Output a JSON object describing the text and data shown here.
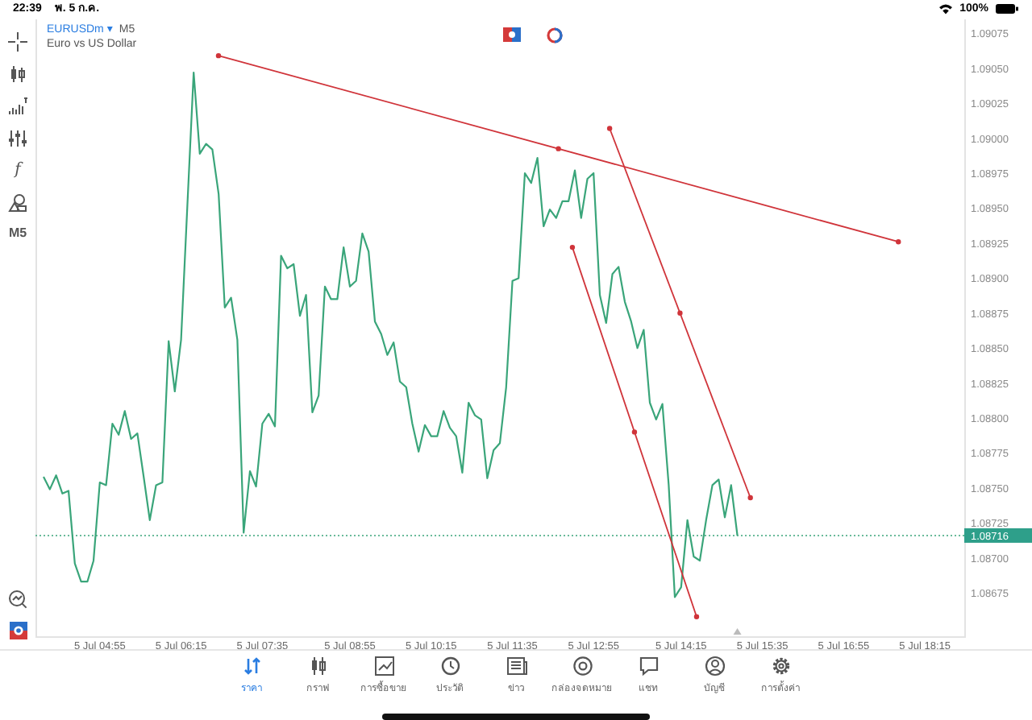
{
  "status_bar": {
    "time": "22:39",
    "date": "พ. 5 ก.ค.",
    "battery": "100%"
  },
  "toolbar": {
    "function_label": "f",
    "timeframe": "M5"
  },
  "chart_header": {
    "symbol": "EURUSDm",
    "dropdown": "▾",
    "timeframe": "M5",
    "description": "Euro vs US Dollar"
  },
  "chart": {
    "chart_data": {
      "type": "line",
      "ylim": [
        1.08644,
        1.09085
      ],
      "ref_lines": [
        {
          "axis": "y",
          "value": 1.08716,
          "label": "1.08716",
          "color": "#3aa57a"
        }
      ],
      "categories": [
        null,
        null,
        null,
        null,
        null,
        null,
        null,
        null,
        null,
        "5 Jul 04:55",
        null,
        null,
        null,
        null,
        null,
        null,
        null,
        null,
        null,
        null,
        null,
        null,
        "5 Jul 06:15",
        null,
        null,
        null,
        null,
        null,
        null,
        null,
        null,
        null,
        null,
        null,
        null,
        "5 Jul 07:35",
        null,
        null,
        null,
        null,
        null,
        null,
        null,
        null,
        null,
        null,
        null,
        null,
        null,
        "5 Jul 08:55",
        null,
        null,
        null,
        null,
        null,
        null,
        null,
        null,
        null,
        null,
        null,
        null,
        "5 Jul 10:15",
        null,
        null,
        null,
        null,
        null,
        null,
        null,
        null,
        null,
        null,
        null,
        null,
        "5 Jul 11:35",
        null,
        null,
        null,
        null,
        null,
        null,
        null,
        null,
        null,
        null,
        null,
        null,
        "5 Jul 12:55",
        null,
        null,
        null,
        null,
        null,
        null,
        null,
        null,
        null,
        null,
        null,
        null,
        null,
        "5 Jul 14:15",
        null,
        null,
        null,
        null,
        null,
        null,
        null,
        null,
        null,
        null,
        null,
        null,
        "5 Jul 15:35",
        null,
        null,
        null,
        null,
        null,
        null,
        null,
        null,
        null,
        null,
        null,
        null,
        "5 Jul 16:55",
        null,
        null,
        null,
        null,
        null,
        null,
        null,
        null,
        null,
        null,
        null,
        null,
        "5 Jul 18:15",
        null,
        null,
        null,
        null,
        null,
        null
      ],
      "yticks": [
        {
          "value": 1.09075,
          "label": "1.09075"
        },
        {
          "value": 1.0905,
          "label": "1.09050"
        },
        {
          "value": 1.09025,
          "label": "1.09025"
        },
        {
          "value": 1.09,
          "label": "1.09000"
        },
        {
          "value": 1.08975,
          "label": "1.08975"
        },
        {
          "value": 1.0895,
          "label": "1.08950"
        },
        {
          "value": 1.08925,
          "label": "1.08925"
        },
        {
          "value": 1.089,
          "label": "1.08900"
        },
        {
          "value": 1.08875,
          "label": "1.08875"
        },
        {
          "value": 1.0885,
          "label": "1.08850"
        },
        {
          "value": 1.08825,
          "label": "1.08825"
        },
        {
          "value": 1.088,
          "label": "1.08800"
        },
        {
          "value": 1.08775,
          "label": "1.08775"
        },
        {
          "value": 1.0875,
          "label": "1.08750"
        },
        {
          "value": 1.08725,
          "label": "1.08725"
        },
        {
          "value": 1.087,
          "label": "1.08700"
        },
        {
          "value": 1.08675,
          "label": "1.08675"
        }
      ],
      "series": [
        {
          "color": "#3aa57a",
          "values": [
            1.08758,
            1.08749,
            1.08759,
            1.08746,
            1.08748,
            1.08696,
            1.08683,
            1.08683,
            1.08698,
            1.08754,
            1.08752,
            1.08796,
            1.08788,
            1.08805,
            1.08785,
            1.08789,
            1.08758,
            1.08727,
            1.08752,
            1.08754,
            1.08855,
            1.08819,
            1.08856,
            1.08952,
            1.09047,
            1.08989,
            1.08996,
            1.08992,
            1.0896,
            1.08879,
            1.08886,
            1.08856,
            1.08718,
            1.08762,
            1.08751,
            1.08796,
            1.08803,
            1.08794,
            1.08916,
            1.08907,
            1.0891,
            1.08873,
            1.08888,
            1.08804,
            1.08816,
            1.08894,
            1.08885,
            1.08885,
            1.08922,
            1.08894,
            1.08898,
            1.08932,
            1.08919,
            1.08869,
            1.0886,
            1.08845,
            1.08854,
            1.08826,
            1.08822,
            1.08796,
            1.08776,
            1.08795,
            1.08787,
            1.08787,
            1.08805,
            1.08793,
            1.08787,
            1.08761,
            1.08811,
            1.08802,
            1.08799,
            1.08757,
            1.08777,
            1.08782,
            1.08822,
            1.08898,
            1.089,
            1.08975,
            1.08968,
            1.08986,
            1.08937,
            1.08949,
            1.08943,
            1.08955,
            1.08955,
            1.08977,
            1.08943,
            1.08971,
            1.08975,
            1.08888,
            1.08868,
            1.08903,
            1.08908,
            1.08883,
            1.08869,
            1.0885,
            1.08863,
            1.08811,
            1.08799,
            1.0881,
            1.08752,
            1.08672,
            1.08679,
            1.08727,
            1.08701,
            1.08698,
            1.08727,
            1.08752,
            1.08756,
            1.08729,
            1.08752,
            1.08716,
            null,
            null,
            null,
            null,
            null,
            null,
            null,
            null,
            null,
            null,
            null,
            null,
            null,
            null,
            null,
            null,
            null,
            null,
            null,
            null,
            null,
            null,
            null,
            null,
            null,
            null,
            null,
            null,
            null,
            null,
            null,
            null,
            null,
            null,
            null,
            null
          ]
        }
      ]
    }
  },
  "bottom_nav": [
    {
      "label": "ราคา",
      "selected": true
    },
    {
      "label": "กราฟ",
      "selected": false
    },
    {
      "label": "การซื้อขาย",
      "selected": false
    },
    {
      "label": "ประวัติ",
      "selected": false
    },
    {
      "label": "ข่าว",
      "selected": false
    },
    {
      "label": "กล่องจดหมาย",
      "selected": false
    },
    {
      "label": "แชท",
      "selected": false
    },
    {
      "label": "บัญชี",
      "selected": false
    },
    {
      "label": "การตั้งค่า",
      "selected": false
    }
  ]
}
